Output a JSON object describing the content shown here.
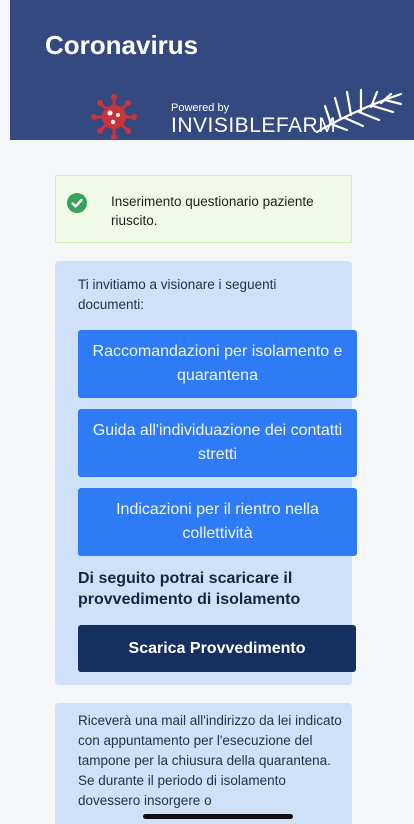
{
  "header": {
    "title": "Coronavirus",
    "powered_by": "Powered by",
    "brand": "INVISIBLEFARM"
  },
  "alert": {
    "icon": "check-circle-icon",
    "message": "Inserimento questionario paziente riuscito."
  },
  "documents": {
    "intro": "Ti invitiamo a visionare i seguenti documenti:",
    "buttons": [
      {
        "label": "Raccomandazioni per isolamento e quarantena"
      },
      {
        "label": "Guida all'individuazione dei contatti stretti"
      },
      {
        "label": "Indicazioni per il rientro nella collettività"
      }
    ],
    "subheading": "Di seguito potrai scaricare il provvedimento di isolamento",
    "download_label": "Scarica Provvedimento"
  },
  "info": {
    "text": "Riceverà una mail all'indirizzo da lei indicato con appuntamento per l'esecuzione del tampone per la chiusura della quarantena. Se durante il periodo di isolamento dovessero insorgere o"
  },
  "colors": {
    "header_bg": "#34497f",
    "panel_bg": "#cfe1f8",
    "doc_button_bg": "#2e7bf5",
    "download_button_bg": "#152f5e",
    "alert_bg": "#f0fae6",
    "virus_red": "#c8343a"
  }
}
